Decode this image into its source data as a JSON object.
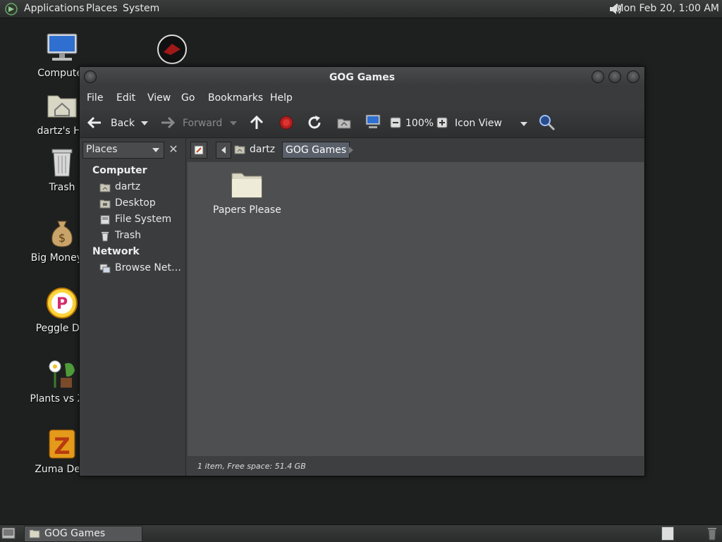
{
  "top_panel": {
    "menus": [
      "Applications",
      "Places",
      "System"
    ],
    "clock": "Mon Feb 20,  1:00 AM"
  },
  "desktop": {
    "icons": [
      {
        "label": "Computer",
        "icon": "computer-icon"
      },
      {
        "label": "dartz's Ho",
        "icon": "home-folder-icon"
      },
      {
        "label": "Trash",
        "icon": "trash-icon"
      },
      {
        "label": "Big Money D",
        "icon": "money-bag-icon"
      },
      {
        "label": "Peggle Del",
        "icon": "peggle-icon"
      },
      {
        "label": "Plants vs Zor",
        "icon": "plants-vs-zombies-icon"
      },
      {
        "label": "Zuma Delu",
        "icon": "zuma-icon"
      }
    ]
  },
  "window": {
    "title": "GOG Games",
    "menubar": [
      "File",
      "Edit",
      "View",
      "Go",
      "Bookmarks",
      "Help"
    ],
    "toolbar": {
      "back": "Back",
      "forward": "Forward",
      "zoom": "100%",
      "view_mode": "Icon View"
    },
    "sidebar": {
      "selector": "Places",
      "sections": [
        {
          "heading": "Computer",
          "items": [
            "dartz",
            "Desktop",
            "File System",
            "Trash"
          ]
        },
        {
          "heading": "Network",
          "items": [
            "Browse Net…"
          ]
        }
      ]
    },
    "breadcrumb": {
      "home": "dartz",
      "current": "GOG Games"
    },
    "files": [
      {
        "name": "Papers Please",
        "icon": "folder-icon"
      }
    ],
    "status": "1 item, Free space: 51.4 GB"
  },
  "bottom_panel": {
    "task": "GOG Games"
  }
}
